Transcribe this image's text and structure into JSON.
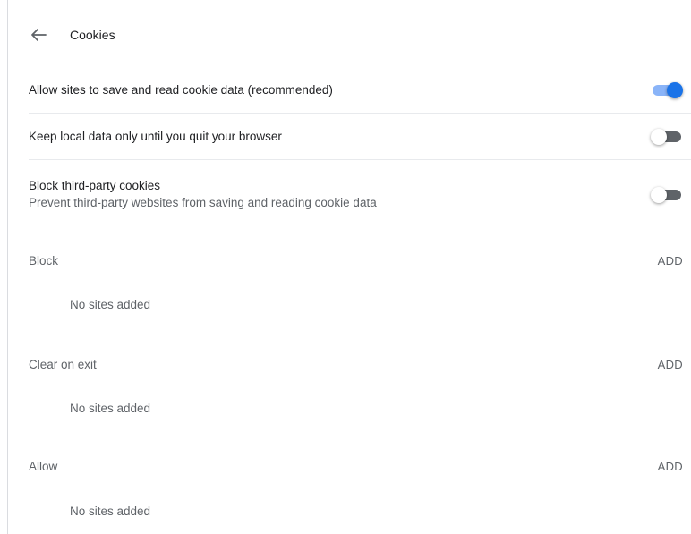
{
  "header": {
    "title": "Cookies"
  },
  "settings": [
    {
      "label": "Allow sites to save and read cookie data (recommended)",
      "state": "on"
    },
    {
      "label": "Keep local data only until you quit your browser",
      "state": "off"
    },
    {
      "label": "Block third-party cookies",
      "sublabel": "Prevent third-party websites from saving and reading cookie data",
      "state": "off"
    }
  ],
  "sections": [
    {
      "label": "Block",
      "action": "ADD",
      "empty_text": "No sites added"
    },
    {
      "label": "Clear on exit",
      "action": "ADD",
      "empty_text": "No sites added"
    },
    {
      "label": "Allow",
      "action": "ADD",
      "empty_text": "No sites added"
    }
  ],
  "colors": {
    "accent": "#1a73e8",
    "accent_track": "#8ab4f8",
    "secondary_text": "#5f6368"
  }
}
